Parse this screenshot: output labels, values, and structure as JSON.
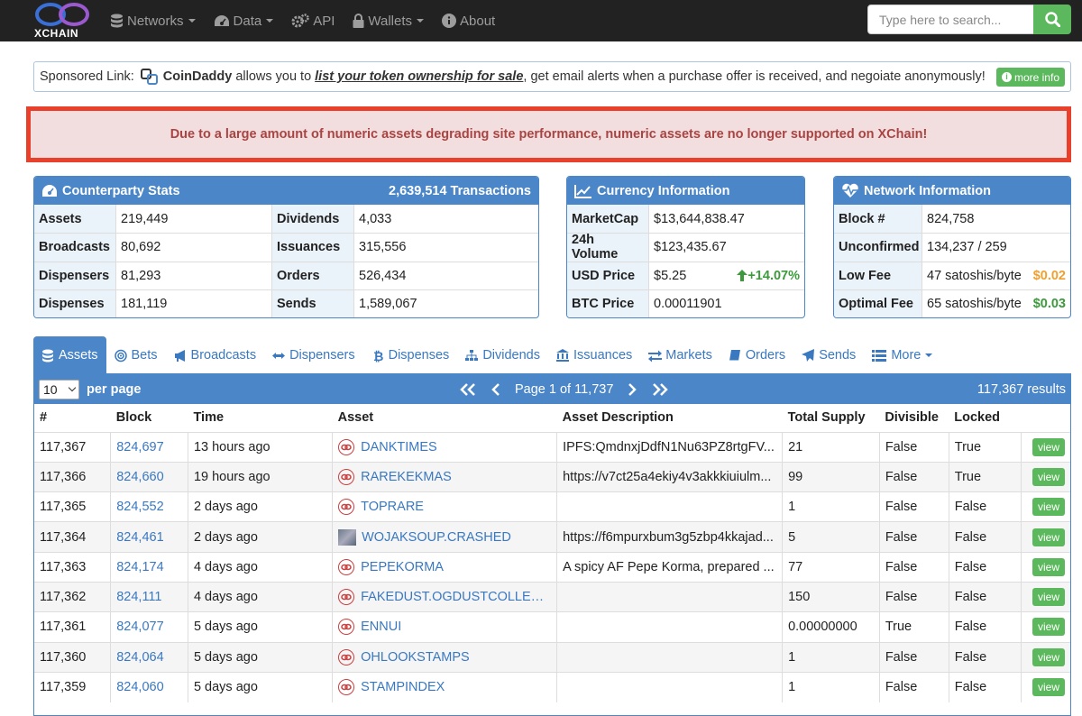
{
  "nav": {
    "logo_text": "XCHAIN",
    "items": [
      {
        "label": "Networks",
        "caret": true,
        "icon": "database-icon"
      },
      {
        "label": "Data",
        "caret": true,
        "icon": "dashboard-icon"
      },
      {
        "label": "API",
        "caret": false,
        "icon": "cogs-icon"
      },
      {
        "label": "Wallets",
        "caret": true,
        "icon": "lock-icon"
      },
      {
        "label": "About",
        "caret": false,
        "icon": "info-icon"
      }
    ],
    "search_placeholder": "Type here to search..."
  },
  "sponsor": {
    "prefix": "Sponsored Link:",
    "brand": "CoinDaddy",
    "text1": "allows you to",
    "link": "list your token ownership for sale",
    "text2": ", get email alerts when a purchase offer is received, and negoiate anonymously!",
    "more_info": "more info"
  },
  "alert": "Due to a large amount of numeric assets degrading site performance, numeric assets are no longer supported on XChain!",
  "counterparty": {
    "title": "Counterparty Stats",
    "transactions": "2,639,514 Transactions",
    "rows": [
      {
        "l1": "Assets",
        "v1": "219,449",
        "l2": "Dividends",
        "v2": "4,033"
      },
      {
        "l1": "Broadcasts",
        "v1": "80,692",
        "l2": "Issuances",
        "v2": "315,556"
      },
      {
        "l1": "Dispensers",
        "v1": "81,293",
        "l2": "Orders",
        "v2": "526,434"
      },
      {
        "l1": "Dispenses",
        "v1": "181,119",
        "l2": "Sends",
        "v2": "1,589,067"
      }
    ]
  },
  "currency": {
    "title": "Currency Information",
    "rows": [
      {
        "l": "MarketCap",
        "v": "$13,644,838.47",
        "x": ""
      },
      {
        "l": "24h Volume",
        "v": "$123,435.67",
        "x": ""
      },
      {
        "l": "USD Price",
        "v": "$5.25",
        "x": "+14.07%"
      },
      {
        "l": "BTC Price",
        "v": "0.00011901",
        "x": ""
      }
    ]
  },
  "network": {
    "title": "Network Information",
    "rows": [
      {
        "l": "Block #",
        "v": "824,758",
        "x": ""
      },
      {
        "l": "Unconfirmed",
        "v": "134,237 / 259",
        "x": ""
      },
      {
        "l": "Low Fee",
        "v": "47 satoshis/byte",
        "x": "$0.02"
      },
      {
        "l": "Optimal Fee",
        "v": "65 satoshis/byte",
        "x": "$0.03"
      }
    ]
  },
  "colors": {
    "low_fee": "#f0a030",
    "optimal_fee": "#3c9a3c",
    "usd_change": "#3c9a3c"
  },
  "tabs": [
    {
      "label": "Assets",
      "icon": "coins-icon"
    },
    {
      "label": "Bets",
      "icon": "bullseye-icon"
    },
    {
      "label": "Broadcasts",
      "icon": "bullhorn-icon"
    },
    {
      "label": "Dispensers",
      "icon": "arrows-h-icon"
    },
    {
      "label": "Dispenses",
      "icon": "bitcoin-icon"
    },
    {
      "label": "Dividends",
      "icon": "sitemap-icon"
    },
    {
      "label": "Issuances",
      "icon": "bank-icon"
    },
    {
      "label": "Markets",
      "icon": "exchange-icon"
    },
    {
      "label": "Orders",
      "icon": "book-icon"
    },
    {
      "label": "Sends",
      "icon": "send-icon"
    },
    {
      "label": "More",
      "icon": "list-icon"
    }
  ],
  "table_bar": {
    "per_page_value": "10",
    "per_page_label": "per page",
    "page_text": "Page 1 of 11,737",
    "results": "117,367 results"
  },
  "columns": [
    "#",
    "Block",
    "Time",
    "Asset",
    "Asset Description",
    "Total Supply",
    "Divisible",
    "Locked",
    ""
  ],
  "rows": [
    {
      "num": "117,367",
      "block": "824,697",
      "time": "13 hours ago",
      "asset": "DANKTIMES",
      "img": false,
      "desc": "IPFS:QmdnxjDdfN1Nu63PZ8rtgFV...",
      "supply": "21",
      "divisible": "False",
      "locked": "True"
    },
    {
      "num": "117,366",
      "block": "824,660",
      "time": "19 hours ago",
      "asset": "RAREKEKMAS",
      "img": false,
      "desc": "https://v7ct25a4ekiy4v3akkkiuiulm...",
      "supply": "99",
      "divisible": "False",
      "locked": "True"
    },
    {
      "num": "117,365",
      "block": "824,552",
      "time": "2 days ago",
      "asset": "TOPRARE",
      "img": false,
      "desc": "",
      "supply": "1",
      "divisible": "False",
      "locked": "False"
    },
    {
      "num": "117,364",
      "block": "824,461",
      "time": "2 days ago",
      "asset": "WOJAKSOUP.CRASHED",
      "img": true,
      "desc": "https://f6mpurxbum3g5zbp4kkajad...",
      "supply": "5",
      "divisible": "False",
      "locked": "False"
    },
    {
      "num": "117,363",
      "block": "824,174",
      "time": "4 days ago",
      "asset": "PEPEKORMA",
      "img": false,
      "desc": "A spicy AF Pepe Korma, prepared ...",
      "supply": "77",
      "divisible": "False",
      "locked": "False"
    },
    {
      "num": "117,362",
      "block": "824,111",
      "time": "4 days ago",
      "asset": "FAKEDUST.OGDUSTCOLLECT...",
      "img": false,
      "desc": "",
      "supply": "150",
      "divisible": "False",
      "locked": "False"
    },
    {
      "num": "117,361",
      "block": "824,077",
      "time": "5 days ago",
      "asset": "ENNUI",
      "img": false,
      "desc": "",
      "supply": "0.00000000",
      "divisible": "True",
      "locked": "False"
    },
    {
      "num": "117,360",
      "block": "824,064",
      "time": "5 days ago",
      "asset": "OHLOOKSTAMPS",
      "img": false,
      "desc": "",
      "supply": "1",
      "divisible": "False",
      "locked": "False"
    },
    {
      "num": "117,359",
      "block": "824,060",
      "time": "5 days ago",
      "asset": "STAMPINDEX",
      "img": false,
      "desc": "",
      "supply": "1",
      "divisible": "False",
      "locked": "False"
    }
  ],
  "view_label": "view"
}
